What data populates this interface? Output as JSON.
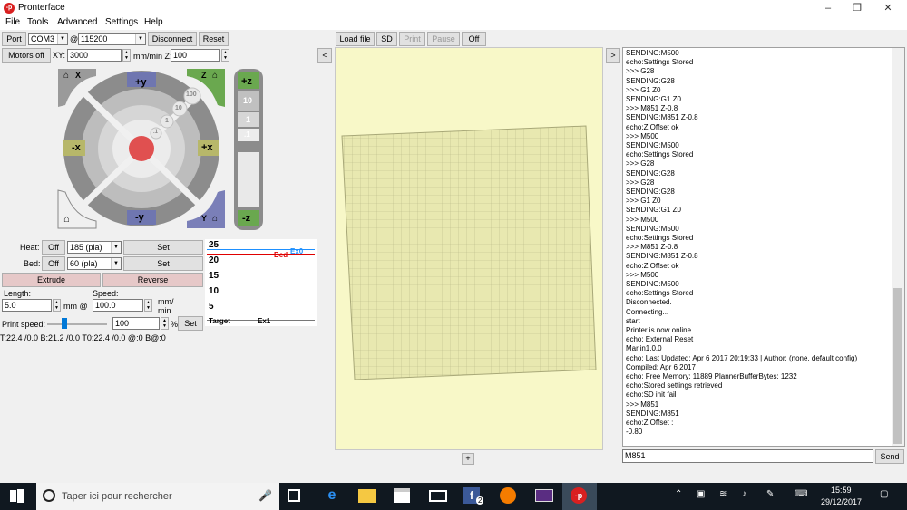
{
  "window": {
    "title": "Pronterface",
    "logo_text": "-p"
  },
  "menu": [
    "File",
    "Tools",
    "Advanced",
    "Settings",
    "Help"
  ],
  "connection": {
    "port_label": "Port",
    "port_value": "COM3",
    "at": "@",
    "baud_value": "115200",
    "disconnect_label": "Disconnect",
    "reset_label": "Reset"
  },
  "motion": {
    "motors_off_label": "Motors off",
    "xy_label": "XY:",
    "xy_feed": "3000",
    "feed_unit": "mm/min Z:",
    "z_feed": "100"
  },
  "jog": {
    "home_x": "X",
    "home_z": "Z",
    "home_y": "Y",
    "plus_y": "+y",
    "minus_y": "-y",
    "plus_x": "+x",
    "minus_x": "-x",
    "plus_z": "+z",
    "minus_z": "-z",
    "steps": [
      "100",
      "10",
      "1",
      ".1"
    ],
    "z_steps": [
      "10",
      "1",
      ".1"
    ]
  },
  "temps": {
    "heat_label": "Heat:",
    "bed_label": "Bed:",
    "off_label": "Off",
    "heat_value": "185 (pla)",
    "bed_value": "60 (pla)",
    "set_label": "Set",
    "extrude_label": "Extrude",
    "reverse_label": "Reverse",
    "length_label": "Length:",
    "length_value": "5.0",
    "mm_at": "mm @",
    "speed_label": "Speed:",
    "speed_value": "100.0",
    "speed_unit_top": "mm/",
    "speed_unit_bottom": "min",
    "print_speed_label": "Print speed:",
    "print_speed_value": "100",
    "percent": "%",
    "status_line": "T:22.4 /0.0 B:21.2 /0.0 T0:22.4 /0.0 @:0 B@:0"
  },
  "graph": {
    "ticks": [
      "25",
      "20",
      "15",
      "10",
      "5"
    ],
    "target_label": "Target",
    "ex1_label": "Ex1",
    "bed_label": "Bed",
    "ex0_label": "Ex0",
    "bed_color": "#e00000",
    "ex0_color": "#1e90ff"
  },
  "toolbar": {
    "collapse_left": "<",
    "load_file": "Load file",
    "sd": "SD",
    "print": "Print",
    "pause": "Pause",
    "off": "Off",
    "expand_right": ">",
    "plus": "+"
  },
  "console": {
    "lines": [
      "SENDING:M500",
      "echo:Settings Stored",
      ">>> G28",
      "SENDING:G28",
      ">>> G1 Z0",
      "SENDING:G1 Z0",
      ">>> M851 Z-0.8",
      "SENDING:M851 Z-0.8",
      "echo:Z Offset ok",
      ">>> M500",
      "SENDING:M500",
      "echo:Settings Stored",
      ">>> G28",
      "SENDING:G28",
      ">>> G28",
      "SENDING:G28",
      ">>> G1 Z0",
      "SENDING:G1 Z0",
      ">>> M500",
      "SENDING:M500",
      "echo:Settings Stored",
      ">>> M851 Z-0.8",
      "SENDING:M851 Z-0.8",
      "echo:Z Offset ok",
      ">>> M500",
      "SENDING:M500",
      "echo:Settings Stored",
      "Disconnected.",
      "Connecting...",
      "start",
      "Printer is now online.",
      "echo: External Reset",
      "Marlin1.0.0",
      "echo: Last Updated: Apr  6 2017 20:19:33 | Author: (none, default config)",
      "Compiled: Apr  6 2017",
      "echo: Free Memory: 11889  PlannerBufferBytes: 1232",
      "echo:Stored settings retrieved",
      "echo:SD init fail",
      ">>> M851",
      "SENDING:M851",
      "echo:Z Offset :",
      "-0.80"
    ],
    "input_value": "M851",
    "send_label": "Send"
  },
  "taskbar": {
    "search_placeholder": "Taper ici pour rechercher",
    "time": "15:59",
    "date": "29/12/2017",
    "fb_badge": "2"
  }
}
